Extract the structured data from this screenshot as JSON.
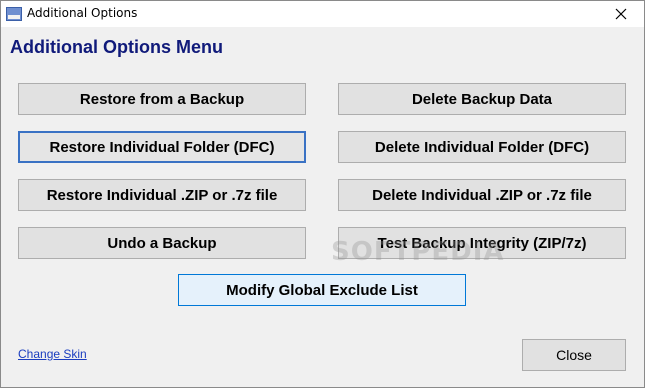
{
  "window": {
    "title": "Additional Options"
  },
  "heading": "Additional Options Menu",
  "buttons": {
    "restore_backup": "Restore from a Backup",
    "delete_backup_data": "Delete Backup Data",
    "restore_folder_dfc": "Restore Individual Folder (DFC)",
    "delete_folder_dfc": "Delete Individual Folder (DFC)",
    "restore_zip": "Restore Individual .ZIP or .7z file",
    "delete_zip": "Delete Individual .ZIP or .7z file",
    "undo_backup": "Undo a Backup",
    "test_integrity": "Test Backup Integrity (ZIP/7z)",
    "modify_exclude": "Modify Global Exclude List",
    "close": "Close"
  },
  "links": {
    "change_skin": "Change Skin"
  },
  "watermark": "SOFTPEDIA",
  "colors": {
    "heading": "#101a7a",
    "link": "#1a3dbf",
    "focus_border": "#3a72c4"
  },
  "icons": {
    "app": "app-icon",
    "close": "close-icon"
  }
}
